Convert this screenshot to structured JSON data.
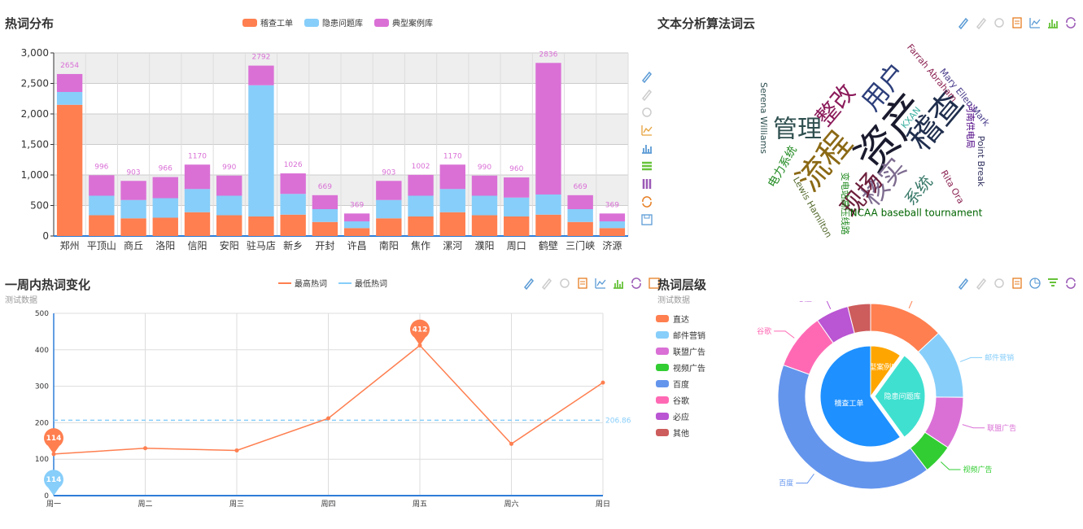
{
  "panels": {
    "hot": {
      "title": "热词分布"
    },
    "cloud": {
      "title": "文本分析算法词云"
    },
    "week": {
      "title": "一周内热词变化",
      "subtitle": "测试数据"
    },
    "level": {
      "title": "热词层级",
      "subtitle": "测试数据"
    }
  },
  "colors": {
    "orange": "#ff7f50",
    "blue": "#87cefa",
    "purple": "#da70d6"
  },
  "chart_data": [
    {
      "type": "bar",
      "stacked": true,
      "categories": [
        "郑州",
        "平顶山",
        "商丘",
        "洛阳",
        "信阳",
        "安阳",
        "驻马店",
        "新乡",
        "开封",
        "许昌",
        "南阳",
        "焦作",
        "漯河",
        "濮阳",
        "周口",
        "鹤壁",
        "三门峡",
        "济源"
      ],
      "series": [
        {
          "name": "稽查工单",
          "color": "#ff7f50",
          "values": [
            2150,
            340,
            290,
            300,
            390,
            340,
            320,
            350,
            230,
            130,
            290,
            320,
            390,
            340,
            320,
            350,
            230,
            130
          ]
        },
        {
          "name": "隐患问题库",
          "color": "#87cefa",
          "values": [
            210,
            320,
            300,
            320,
            380,
            320,
            2150,
            340,
            210,
            110,
            300,
            340,
            380,
            320,
            310,
            330,
            210,
            110
          ]
        },
        {
          "name": "典型案例库",
          "color": "#da70d6",
          "values": [
            294,
            336,
            313,
            346,
            400,
            330,
            322,
            336,
            229,
            129,
            313,
            342,
            400,
            330,
            330,
            2156,
            229,
            129
          ]
        }
      ],
      "totals": [
        2654,
        996,
        903,
        966,
        1170,
        990,
        2792,
        1026,
        669,
        369,
        903,
        1002,
        1170,
        990,
        960,
        2836,
        669,
        369
      ],
      "y_ticks": [
        "0",
        "500",
        "1,000",
        "1,500",
        "2,000",
        "2,500",
        "3,000"
      ],
      "ylim": [
        0,
        3000
      ],
      "grid": true,
      "legend": "top-center"
    },
    {
      "type": "line",
      "categories": [
        "周一",
        "周二",
        "周三",
        "周四",
        "周五",
        "周六",
        "周日"
      ],
      "series": [
        {
          "name": "最高热词",
          "color": "#ff7f50",
          "values": [
            114,
            130,
            124,
            212,
            412,
            142,
            310
          ]
        },
        {
          "name": "最低热词",
          "color": "#87cefa",
          "values": [
            114
          ]
        }
      ],
      "max_label": "412",
      "start_label": "114",
      "min_label": "114",
      "average": 206.86,
      "average_label": "206.86",
      "y_ticks": [
        "0",
        "100",
        "200",
        "300",
        "400",
        "500"
      ],
      "ylim": [
        0,
        500
      ],
      "grid": true,
      "legend": "top-center"
    },
    {
      "type": "pie",
      "inner": [
        {
          "name": "稽查工单",
          "value": 60,
          "color": "#1e90ff"
        },
        {
          "name": "隐患问题库",
          "value": 30,
          "color": "#40e0d0"
        },
        {
          "name": "典型案例库",
          "value": 10,
          "color": "#ffa500"
        }
      ],
      "outer": [
        {
          "name": "直达",
          "value": 335,
          "color": "#ff7f50"
        },
        {
          "name": "邮件营销",
          "value": 310,
          "color": "#87cefa"
        },
        {
          "name": "联盟广告",
          "value": 234,
          "color": "#da70d6"
        },
        {
          "name": "视频广告",
          "value": 135,
          "color": "#32cd32"
        },
        {
          "name": "百度",
          "value": 1048,
          "color": "#6495ed"
        },
        {
          "name": "谷歌",
          "value": 251,
          "color": "#ff69b4"
        },
        {
          "name": "必应",
          "value": 147,
          "color": "#ba55d3"
        },
        {
          "name": "其他",
          "value": 102,
          "color": "#cd5c5c"
        }
      ],
      "legend": "left"
    }
  ],
  "wordcloud": [
    {
      "text": "资产",
      "color": "#1a1a2e",
      "size": 52
    },
    {
      "text": "稽查",
      "color": "#1f2e4d",
      "size": 40
    },
    {
      "text": "流程",
      "color": "#8b6914",
      "size": 40
    },
    {
      "text": "用户",
      "color": "#2c3e7a",
      "size": 32
    },
    {
      "text": "核实",
      "color": "#7d6b8f",
      "size": 32
    },
    {
      "text": "管理",
      "color": "#2f4f4f",
      "size": 30
    },
    {
      "text": "现场",
      "color": "#6b1d3a",
      "size": 30
    },
    {
      "text": "整改",
      "color": "#8b1a5a",
      "size": 28
    },
    {
      "text": "系统",
      "color": "#3a7a6a",
      "size": 20
    },
    {
      "text": "电力系统",
      "color": "#228b22",
      "size": 14
    },
    {
      "text": "Farrah Abraham",
      "color": "#8b2252",
      "size": 11
    },
    {
      "text": "Mary Ellen Mark",
      "color": "#483d8b",
      "size": 11
    },
    {
      "text": "Serena Williams",
      "color": "#2f4f4f",
      "size": 11
    },
    {
      "text": "河南供电局",
      "color": "#4b0082",
      "size": 11
    },
    {
      "text": "Point Break",
      "color": "#2f2f5f",
      "size": 11
    },
    {
      "text": "KXAN",
      "color": "#3cb0a0",
      "size": 11
    },
    {
      "text": "Rita Ora",
      "color": "#8b2252",
      "size": 11
    },
    {
      "text": "Lewis Hamilton",
      "color": "#556b2f",
      "size": 11
    },
    {
      "text": "变电站高压线路",
      "color": "#228b22",
      "size": 11
    },
    {
      "text": "NCAA baseball tournament",
      "color": "#006400",
      "size": 12
    }
  ]
}
